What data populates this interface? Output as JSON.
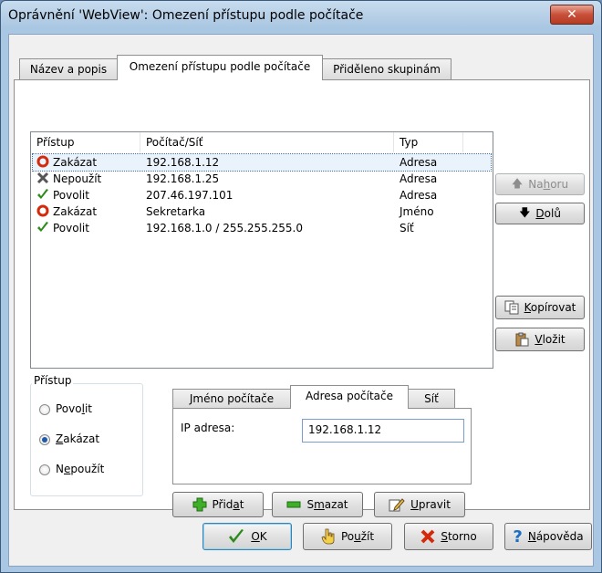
{
  "window": {
    "title": "Oprávnění 'WebView': Omezení přístupu podle počítače",
    "close_glyph": "✕"
  },
  "tabs": [
    {
      "label": "Název a popis"
    },
    {
      "label": "Omezení přístupu podle počítače"
    },
    {
      "label": "Přiděleno skupinám"
    }
  ],
  "list": {
    "columns": [
      "Přístup",
      "Počítač/Síť",
      "Typ"
    ],
    "rows": [
      {
        "access": "Zakázat",
        "target": "192.168.1.12",
        "type": "Adresa",
        "icon": "deny-icon",
        "selected": true
      },
      {
        "access": "Nepoužít",
        "target": "192.168.1.25",
        "type": "Adresa",
        "icon": "unused-icon"
      },
      {
        "access": "Povolit",
        "target": "207.46.197.101",
        "type": "Adresa",
        "icon": "allow-icon"
      },
      {
        "access": "Zakázat",
        "target": "Sekretarka",
        "type": "Jméno",
        "icon": "deny-icon"
      },
      {
        "access": "Povolit",
        "target": "192.168.1.0 / 255.255.255.0",
        "type": "Síť",
        "icon": "allow-icon"
      }
    ]
  },
  "side_buttons": {
    "up": {
      "pre": "Na",
      "u": "h",
      "post": "oru",
      "disabled": true
    },
    "down": {
      "pre": "",
      "u": "D",
      "post": "olů"
    },
    "copy": {
      "pre": "",
      "u": "K",
      "post": "opírovat"
    },
    "paste": {
      "pre": "",
      "u": "V",
      "post": "ložit"
    }
  },
  "access_group": {
    "label": "Přístup",
    "options": [
      {
        "pre": "Povo",
        "u": "l",
        "post": "it",
        "checked": false
      },
      {
        "pre": "",
        "u": "Z",
        "post": "akázat",
        "checked": true
      },
      {
        "pre": "N",
        "u": "e",
        "post": "použít",
        "checked": false
      }
    ]
  },
  "inner_tabs": [
    {
      "label": "Jméno počítače"
    },
    {
      "label": "Adresa počítače"
    },
    {
      "label": "Síť"
    }
  ],
  "address_form": {
    "label": "IP adresa:",
    "value": "192.168.1.12"
  },
  "action_buttons": {
    "add": {
      "pre": "Přid",
      "u": "a",
      "post": "t"
    },
    "delete": {
      "pre": "S",
      "u": "m",
      "post": "azat"
    },
    "edit": {
      "pre": "",
      "u": "U",
      "post": "pravit"
    }
  },
  "dialog_buttons": {
    "ok": {
      "pre": "",
      "u": "O",
      "post": "K"
    },
    "apply": {
      "pre": "Po",
      "u": "u",
      "post": "žít"
    },
    "cancel": {
      "pre": "",
      "u": "S",
      "post": "torno"
    },
    "help": {
      "pre": "",
      "u": "N",
      "post": "ápověda"
    }
  },
  "colors": {
    "deny": "#d42a0c",
    "allow": "#2c8a1a",
    "help": "#1b6ec2"
  }
}
